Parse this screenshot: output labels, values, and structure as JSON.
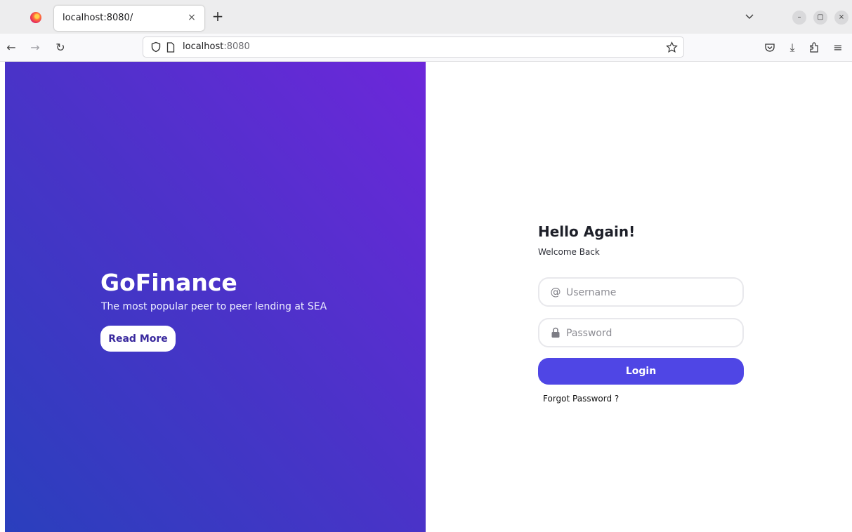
{
  "browser": {
    "tab_title": "localhost:8080/",
    "tab_close": "×",
    "new_tab": "+",
    "url_host": "localhost",
    "url_port": ":8080",
    "window_controls": {
      "minimize": "–",
      "maximize": "▢",
      "close": "×"
    },
    "nav": {
      "back": "←",
      "forward": "→",
      "reload": "↻",
      "downloads": "⤓",
      "menu": "≡"
    },
    "icons": [
      "firefox-logo",
      "shield-icon",
      "page-icon",
      "star-icon",
      "pocket-icon",
      "download-icon",
      "extensions-icon",
      "menu-icon"
    ]
  },
  "hero": {
    "brand": "GoFinance",
    "tagline": "The most popular peer to peer lending at SEA",
    "cta_label": "Read More",
    "gradient": [
      "#2a3fbd",
      "#6d27da"
    ]
  },
  "login": {
    "title": "Hello Again!",
    "subtitle": "Welcome Back",
    "username_icon": "@",
    "username_placeholder": "Username",
    "username_value": "",
    "password_placeholder": "Password",
    "password_value": "",
    "submit_label": "Login",
    "forgot_label": "Forgot Password ?",
    "accent": "#4f46e5"
  }
}
